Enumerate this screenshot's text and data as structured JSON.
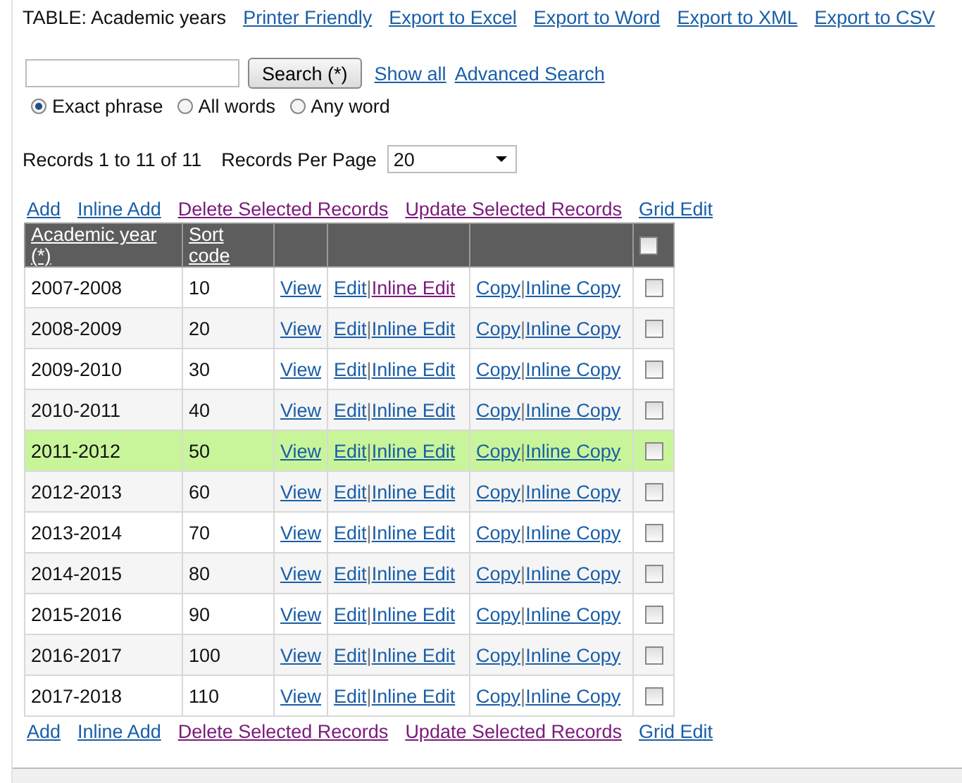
{
  "header": {
    "title": "TABLE: Academic years",
    "links": [
      {
        "label": "Printer Friendly",
        "visited": false
      },
      {
        "label": "Export to Excel",
        "visited": false
      },
      {
        "label": "Export to Word",
        "visited": false
      },
      {
        "label": "Export to XML",
        "visited": false
      },
      {
        "label": "Export to CSV",
        "visited": false
      }
    ]
  },
  "search": {
    "button": "Search (*)",
    "links": [
      {
        "label": "Show all",
        "visited": false
      },
      {
        "label": "Advanced Search",
        "visited": false
      }
    ],
    "modes": [
      {
        "label": "Exact phrase",
        "selected": true
      },
      {
        "label": "All words",
        "selected": false
      },
      {
        "label": "Any word",
        "selected": false
      }
    ]
  },
  "records": {
    "summary": "Records 1 to 11 of 11",
    "per_page_label": "Records Per Page",
    "per_page": "20"
  },
  "top_actions": [
    {
      "label": "Add",
      "visited": false
    },
    {
      "label": "Inline Add",
      "visited": false
    },
    {
      "label": "Delete Selected Records",
      "visited": true
    },
    {
      "label": "Update Selected Records",
      "visited": true
    },
    {
      "label": "Grid Edit",
      "visited": false
    }
  ],
  "table": {
    "columns": [
      "Academic year (*)",
      "Sort code"
    ],
    "select_all_checked": false,
    "rows": [
      {
        "year": "2007-2008",
        "code": "10",
        "highlighted": false,
        "checked": false,
        "links": [
          {
            "label": "View",
            "visited": false
          },
          {
            "label": "Edit",
            "visited": false
          },
          {
            "label": "Inline Edit",
            "visited": true
          },
          {
            "label": "Copy",
            "visited": false
          },
          {
            "label": "Inline Copy",
            "visited": false
          }
        ],
        "separators": [
          "|",
          "|"
        ]
      },
      {
        "year": "2008-2009",
        "code": "20",
        "highlighted": false,
        "checked": false,
        "links": [
          {
            "label": "View",
            "visited": false
          },
          {
            "label": "Edit",
            "visited": false
          },
          {
            "label": "Inline Edit",
            "visited": false
          },
          {
            "label": "Copy",
            "visited": false
          },
          {
            "label": "Inline Copy",
            "visited": false
          }
        ],
        "separators": [
          "|",
          "|"
        ]
      },
      {
        "year": "2009-2010",
        "code": "30",
        "highlighted": false,
        "checked": false,
        "links": [
          {
            "label": "View",
            "visited": false
          },
          {
            "label": "Edit",
            "visited": false
          },
          {
            "label": "Inline Edit",
            "visited": false
          },
          {
            "label": "Copy",
            "visited": false
          },
          {
            "label": "Inline Copy",
            "visited": false
          }
        ],
        "separators": [
          "|",
          "|"
        ]
      },
      {
        "year": "2010-2011",
        "code": "40",
        "highlighted": false,
        "checked": false,
        "links": [
          {
            "label": "View",
            "visited": false
          },
          {
            "label": "Edit",
            "visited": false
          },
          {
            "label": "Inline Edit",
            "visited": false
          },
          {
            "label": "Copy",
            "visited": false
          },
          {
            "label": "Inline Copy",
            "visited": false
          }
        ],
        "separators": [
          "|",
          "|"
        ]
      },
      {
        "year": "2011-2012",
        "code": "50",
        "highlighted": true,
        "checked": false,
        "links": [
          {
            "label": "View",
            "visited": false
          },
          {
            "label": "Edit",
            "visited": false
          },
          {
            "label": "Inline Edit",
            "visited": false
          },
          {
            "label": "Copy",
            "visited": false
          },
          {
            "label": "Inline Copy",
            "visited": false
          }
        ],
        "separators": [
          "|",
          "|"
        ]
      },
      {
        "year": "2012-2013",
        "code": "60",
        "highlighted": false,
        "checked": false,
        "links": [
          {
            "label": "View",
            "visited": false
          },
          {
            "label": "Edit",
            "visited": false
          },
          {
            "label": "Inline Edit",
            "visited": false
          },
          {
            "label": "Copy",
            "visited": false
          },
          {
            "label": "Inline Copy",
            "visited": false
          }
        ],
        "separators": [
          "|",
          "|"
        ]
      },
      {
        "year": "2013-2014",
        "code": "70",
        "highlighted": false,
        "checked": false,
        "links": [
          {
            "label": "View",
            "visited": false
          },
          {
            "label": "Edit",
            "visited": false
          },
          {
            "label": "Inline Edit",
            "visited": false
          },
          {
            "label": "Copy",
            "visited": false
          },
          {
            "label": "Inline Copy",
            "visited": false
          }
        ],
        "separators": [
          "|",
          "|"
        ]
      },
      {
        "year": "2014-2015",
        "code": "80",
        "highlighted": false,
        "checked": false,
        "links": [
          {
            "label": "View",
            "visited": false
          },
          {
            "label": "Edit",
            "visited": false
          },
          {
            "label": "Inline Edit",
            "visited": false
          },
          {
            "label": "Copy",
            "visited": false
          },
          {
            "label": "Inline Copy",
            "visited": false
          }
        ],
        "separators": [
          "|",
          "|"
        ]
      },
      {
        "year": "2015-2016",
        "code": "90",
        "highlighted": false,
        "checked": false,
        "links": [
          {
            "label": "View",
            "visited": false
          },
          {
            "label": "Edit",
            "visited": false
          },
          {
            "label": "Inline Edit",
            "visited": false
          },
          {
            "label": "Copy",
            "visited": false
          },
          {
            "label": "Inline Copy",
            "visited": false
          }
        ],
        "separators": [
          "|",
          "|"
        ]
      },
      {
        "year": "2016-2017",
        "code": "100",
        "highlighted": false,
        "checked": false,
        "links": [
          {
            "label": "View",
            "visited": false
          },
          {
            "label": "Edit",
            "visited": false
          },
          {
            "label": "Inline Edit",
            "visited": false
          },
          {
            "label": "Copy",
            "visited": false
          },
          {
            "label": "Inline Copy",
            "visited": false
          }
        ],
        "separators": [
          "|",
          "|"
        ]
      },
      {
        "year": "2017-2018",
        "code": "110",
        "highlighted": false,
        "checked": false,
        "links": [
          {
            "label": "View",
            "visited": false
          },
          {
            "label": "Edit",
            "visited": false
          },
          {
            "label": "Inline Edit",
            "visited": false
          },
          {
            "label": "Copy",
            "visited": false
          },
          {
            "label": "Inline Copy",
            "visited": false
          }
        ],
        "separators": [
          "|",
          "|"
        ]
      }
    ]
  },
  "bottom_actions": [
    {
      "label": "Add",
      "visited": false
    },
    {
      "label": "Inline Add",
      "visited": false
    },
    {
      "label": "Delete Selected Records",
      "visited": true
    },
    {
      "label": "Update Selected Records",
      "visited": true
    },
    {
      "label": "Grid Edit",
      "visited": false
    }
  ]
}
